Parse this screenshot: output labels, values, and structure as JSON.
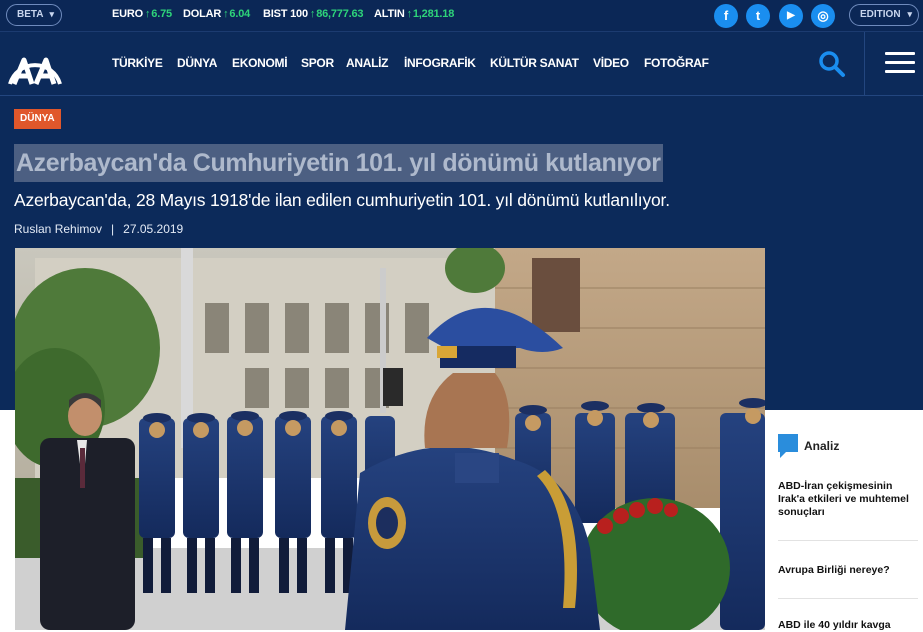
{
  "topbar": {
    "beta_label": "BETA",
    "tickers": [
      {
        "name": "EURO",
        "value": "6.75"
      },
      {
        "name": "DOLAR",
        "value": "6.04"
      },
      {
        "name": "BIST 100",
        "value": "86,777.63"
      },
      {
        "name": "ALTIN",
        "value": "1,281.18"
      }
    ],
    "social": [
      {
        "icon": "facebook-icon",
        "glyph": "f"
      },
      {
        "icon": "twitter-icon",
        "glyph": "t"
      },
      {
        "icon": "youtube-icon",
        "glyph": "▶"
      },
      {
        "icon": "instagram-icon",
        "glyph": "◎"
      }
    ],
    "edition_label": "EDITION"
  },
  "nav": {
    "items": [
      "TÜRKİYE",
      "DÜNYA",
      "EKONOMİ",
      "SPOR",
      "ANALİZ",
      "İNFOGRAFİK",
      "KÜLTÜR SANAT",
      "VİDEO",
      "FOTOĞRAF"
    ]
  },
  "article": {
    "category": "DÜNYA",
    "title": "Azerbaycan'da Cumhuriyetin 101. yıl dönümü kutlanıyor",
    "subtitle": "Azerbaycan'da, 28 Mayıs 1918'de ilan edilen cumhuriyetin 101. yıl dönümü kutlanılıyor.",
    "author": "Ruslan Rehimov",
    "separator": "|",
    "date": "27.05.2019"
  },
  "sidebar": {
    "label": "Analiz",
    "items": [
      "ABD-İran çekişmesinin Irak'a etkileri ve muhtemel sonuçları",
      "Avrupa Birliği nereye?",
      "ABD ile 40 yıldır kavga"
    ]
  },
  "colors": {
    "page_bg": "#0c2a5a",
    "accent_badge": "#e0572b",
    "ticker_up": "#2ed47a",
    "social": "#1a8ef0"
  }
}
